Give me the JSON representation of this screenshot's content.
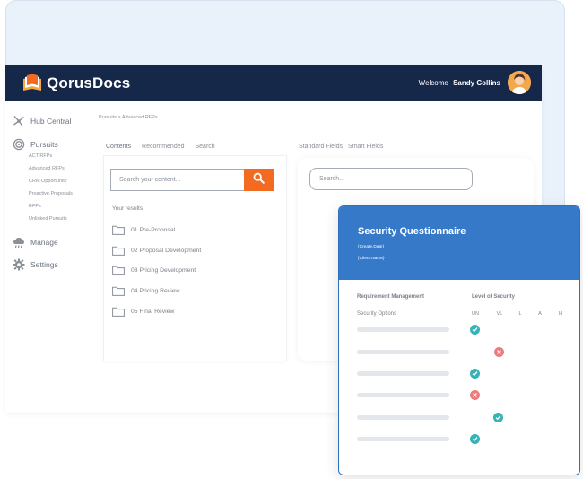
{
  "header": {
    "logo_text": "QorusDocs",
    "welcome_label": "Welcome",
    "user_name": "Sandy Collins"
  },
  "sidebar": {
    "items": [
      {
        "label": "Hub Central",
        "icon": "hub-icon"
      },
      {
        "label": "Pursuits",
        "icon": "target-icon"
      },
      {
        "label": "Manage",
        "icon": "cloud-icon"
      },
      {
        "label": "Settings",
        "icon": "gear-icon"
      }
    ],
    "pursuits_sub": [
      "ACT RFPs",
      "Advanced RFPs",
      "CRM Opportunity",
      "Proactive Proposals",
      "RFPs",
      "Unlinked Pursuits"
    ]
  },
  "breadcrumb": "Pursuits > Advanced RFPs",
  "content_tabs": [
    "Contents",
    "Recommended",
    "Search"
  ],
  "field_tabs": [
    "Standard Fields",
    "Smart Fields"
  ],
  "search": {
    "placeholder": "Search your content..."
  },
  "results": {
    "label": "Your results",
    "folders": [
      "01 Pre-Proposal",
      "02 Proposal Development",
      "03 Pricing Development",
      "04 Pricing Review",
      "05 Final Review"
    ]
  },
  "right_search": {
    "placeholder": "Search..."
  },
  "questionnaire": {
    "title": "Security Questionnaire",
    "fields": [
      "{Create.Date}",
      "{Client.Name}"
    ],
    "col_requirement": "Requirement Management",
    "col_level": "Level of Security",
    "options_label": "Security Options",
    "levels": [
      "UN",
      "VL",
      "L",
      "A",
      "H"
    ],
    "rows": [
      {
        "level": "UN",
        "status": "check"
      },
      {
        "level": "VL",
        "status": "cross"
      },
      {
        "level": "UN",
        "status": "check"
      },
      {
        "level": "UN",
        "status": "cross"
      },
      {
        "level": "VL",
        "status": "check"
      },
      {
        "level": "UN",
        "status": "check"
      }
    ]
  },
  "colors": {
    "header_bg": "#16284a",
    "accent_orange": "#f26b21",
    "card_blue": "#3679c9",
    "check_teal": "#36b3b6",
    "cross_red": "#ee7c7c"
  }
}
